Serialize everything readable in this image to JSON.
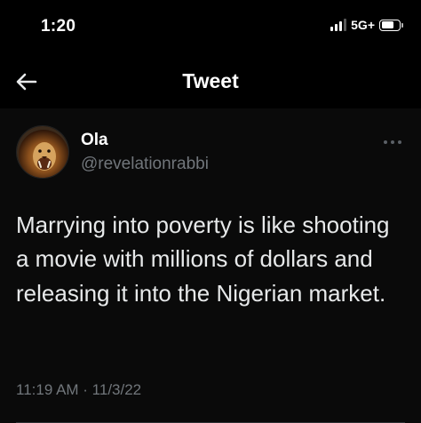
{
  "status_bar": {
    "time": "1:20",
    "network": "5G+",
    "signal_bars": 3,
    "battery_level": 0.7,
    "icons": [
      "signal-icon",
      "battery-icon"
    ]
  },
  "nav": {
    "title": "Tweet",
    "back_icon": "back-arrow-icon"
  },
  "tweet": {
    "author_name": "Ola",
    "handle": "@revelationrabbi",
    "text": "Marrying into poverty is like shooting a movie with millions of dollars and releasing it into the Nigerian market.",
    "timestamp": "11:19 AM · 11/3/22",
    "more_icon": "more-options-icon"
  },
  "colors": {
    "background": "#000000",
    "text_primary": "#e7e9ea",
    "text_secondary": "#71767b",
    "divider": "#2f3336"
  }
}
